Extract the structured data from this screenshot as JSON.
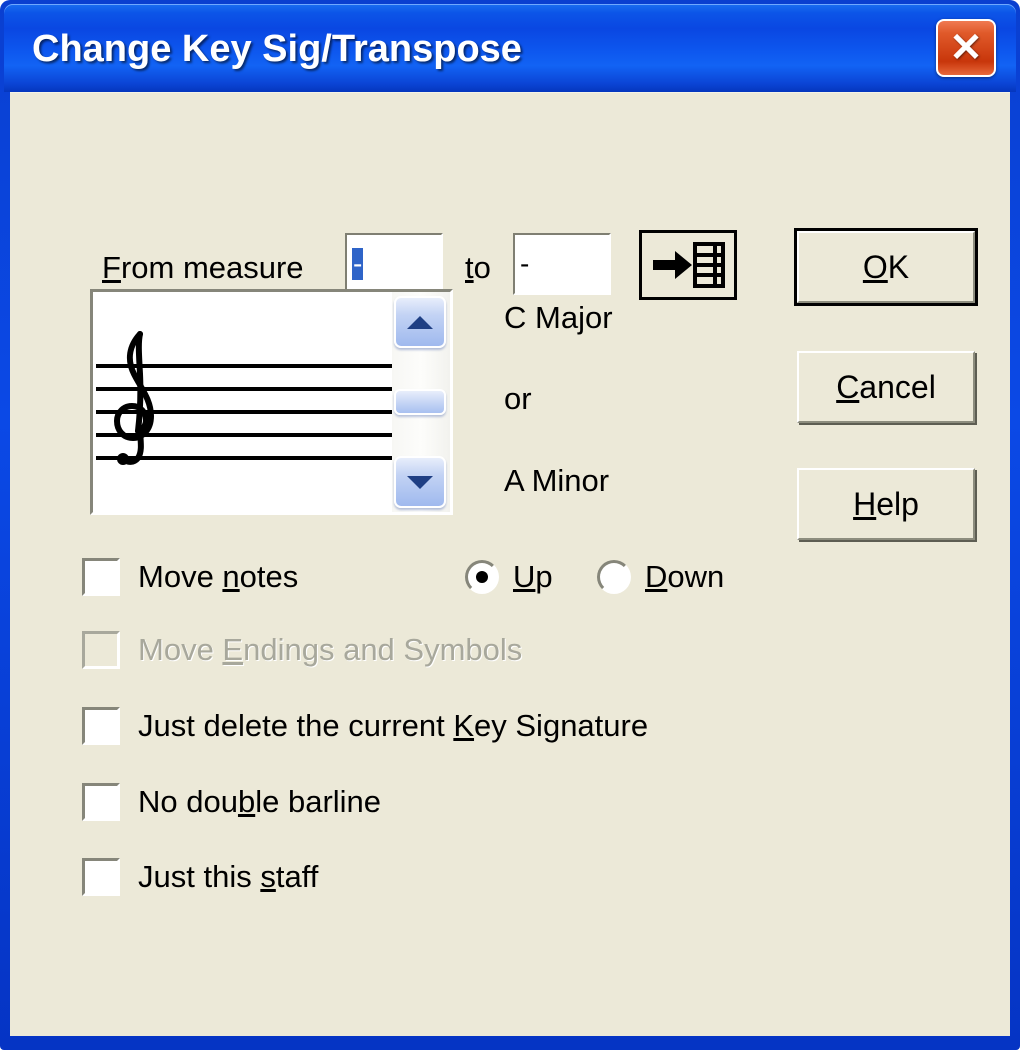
{
  "window": {
    "title": "Change Key Sig/Transpose",
    "close_icon": "close-icon",
    "close_glyph": "✕",
    "titlebar_color": "#0b49e6",
    "client_color": "#ece9d8"
  },
  "measure_range": {
    "from_label_prefix": "F",
    "from_label_rest": "rom measure",
    "from_value": "-",
    "to_label_prefix": "t",
    "to_label_rest": "o",
    "to_value": "-",
    "goto_button_name": "go-to-measure-icon"
  },
  "buttons": {
    "ok": {
      "accel": "O",
      "rest": "K"
    },
    "cancel": {
      "accel": "C",
      "rest": "ancel"
    },
    "help": {
      "accel": "H",
      "rest": "elp"
    }
  },
  "key_preview": {
    "clef": "treble-clef",
    "clef_glyph": "𝄞",
    "staff_lines": 5,
    "scroll_position_percent": 50
  },
  "key_names": {
    "major": "C Major",
    "conjunction": "or",
    "minor": "A Minor"
  },
  "options": {
    "move_notes": {
      "pre": "Move ",
      "accel": "n",
      "post": "otes",
      "checked": false,
      "enabled": true
    },
    "direction": {
      "up": {
        "accel": "U",
        "rest": "p",
        "selected": true
      },
      "down": {
        "accel": "D",
        "rest": "own",
        "selected": false
      }
    },
    "move_endings": {
      "pre": "Move ",
      "accel": "E",
      "post": "ndings and Symbols",
      "checked": false,
      "enabled": false
    },
    "just_delete_key_sig": {
      "pre": "Just delete the current ",
      "accel": "K",
      "post": "ey Signature",
      "checked": false,
      "enabled": true
    },
    "no_double_barline": {
      "pre": "No dou",
      "accel": "b",
      "post": "le barline",
      "checked": false,
      "enabled": true
    },
    "just_this_staff": {
      "pre": "Just this ",
      "accel": "s",
      "post": "taff",
      "checked": false,
      "enabled": true
    }
  }
}
